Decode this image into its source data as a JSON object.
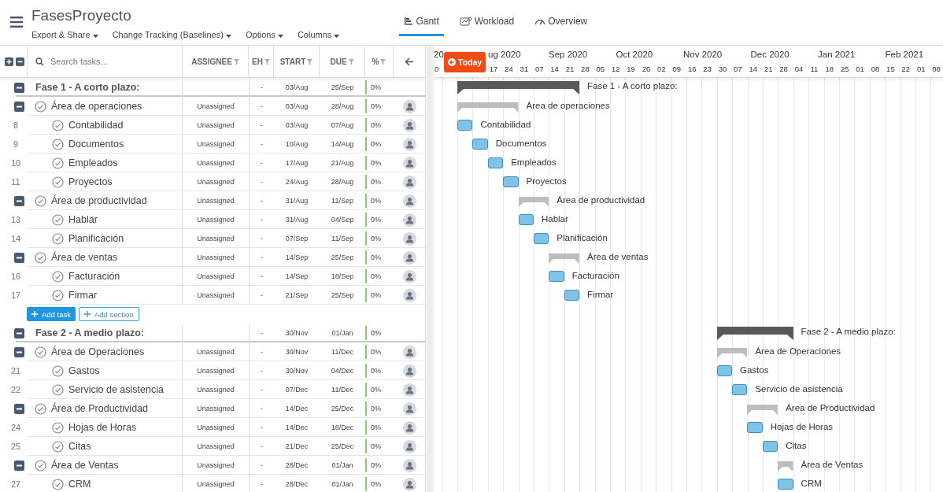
{
  "header": {
    "title": "FasesProyecto",
    "menus": [
      "Export & Share",
      "Change Tracking (Baselines)",
      "Options",
      "Columns"
    ]
  },
  "views": [
    {
      "label": "Gantt",
      "kind": "gantt",
      "selected": true
    },
    {
      "label": "Workload",
      "kind": "workload",
      "selected": false
    },
    {
      "label": "Overview",
      "kind": "overview",
      "selected": false
    }
  ],
  "table": {
    "search": {
      "placeholder": "Search tasks..."
    },
    "columns": [
      "ASSIGNEE",
      "EH",
      "START",
      "DUE",
      "%"
    ]
  },
  "sections": [
    {
      "rows": [
        {
          "kind": "phase",
          "name": "Fase 1 - A corto plazo:",
          "eh": "-",
          "start": "03/Aug",
          "due": "25/Sep",
          "pct": "0%",
          "bar_label": "Fase 1 - A corto plazo:"
        },
        {
          "kind": "group",
          "name": "Área de operaciones",
          "assignee": "Unassigned",
          "eh": "-",
          "start": "03/Aug",
          "due": "28/Aug",
          "pct": "0%",
          "bar_label": "Área de operaciones"
        },
        {
          "kind": "task",
          "number": "8",
          "name": "Contabilidad",
          "assignee": "Unassigned",
          "eh": "-",
          "start": "03/Aug",
          "due": "07/Aug",
          "pct": "0%",
          "bar_label": "Contabilidad"
        },
        {
          "kind": "task",
          "number": "9",
          "name": "Documentos",
          "assignee": "Unassigned",
          "eh": "-",
          "start": "10/Aug",
          "due": "14/Aug",
          "pct": "0%",
          "bar_label": "Documentos"
        },
        {
          "kind": "task",
          "number": "10",
          "name": "Empleados",
          "assignee": "Unassigned",
          "eh": "-",
          "start": "17/Aug",
          "due": "21/Aug",
          "pct": "0%",
          "bar_label": "Empleados"
        },
        {
          "kind": "task",
          "number": "11",
          "name": "Proyectos",
          "assignee": "Unassigned",
          "eh": "-",
          "start": "24/Aug",
          "due": "28/Aug",
          "pct": "0%",
          "bar_label": "Proyectos"
        },
        {
          "kind": "group",
          "name": "Área de productividad",
          "assignee": "Unassigned",
          "eh": "-",
          "start": "31/Aug",
          "due": "11/Sep",
          "pct": "0%",
          "bar_label": "Área de productividad"
        },
        {
          "kind": "task",
          "number": "13",
          "name": "Hablar",
          "assignee": "Unassigned",
          "eh": "-",
          "start": "31/Aug",
          "due": "04/Sep",
          "pct": "0%",
          "bar_label": "Hablar"
        },
        {
          "kind": "task",
          "number": "14",
          "name": "Planificación",
          "assignee": "Unassigned",
          "eh": "-",
          "start": "07/Sep",
          "due": "11/Sep",
          "pct": "0%",
          "bar_label": "Planificación"
        },
        {
          "kind": "group",
          "name": "Área de ventas",
          "assignee": "Unassigned",
          "eh": "-",
          "start": "14/Sep",
          "due": "25/Sep",
          "pct": "0%",
          "bar_label": "Área de ventas"
        },
        {
          "kind": "task",
          "number": "16",
          "name": "Facturación",
          "assignee": "Unassigned",
          "eh": "-",
          "start": "14/Sep",
          "due": "18/Sep",
          "pct": "0%",
          "bar_label": "Facturación"
        },
        {
          "kind": "task",
          "number": "17",
          "name": "Firmar",
          "assignee": "Unassigned",
          "eh": "-",
          "start": "21/Sep",
          "due": "25/Sep",
          "pct": "0%",
          "bar_label": "Firmar"
        }
      ],
      "actions": {
        "add_task": "Add task",
        "add_section": "Add section"
      }
    },
    {
      "rows": [
        {
          "kind": "phase",
          "name": "Fase 2 - A medio plazo:",
          "eh": "-",
          "start": "30/Nov",
          "due": "01/Jan",
          "pct": "0%",
          "bar_label": "Fase 2 - A medio plazo:"
        },
        {
          "kind": "group",
          "name": "Área de Operaciones",
          "assignee": "Unassigned",
          "eh": "-",
          "start": "30/Nov",
          "due": "11/Dec",
          "pct": "0%",
          "bar_label": "Área de Operaciones"
        },
        {
          "kind": "task",
          "number": "21",
          "name": "Gastos",
          "assignee": "Unassigned",
          "eh": "-",
          "start": "30/Nov",
          "due": "04/Dec",
          "pct": "0%",
          "bar_label": "Gastos"
        },
        {
          "kind": "task",
          "number": "22",
          "name": "Servicio de asistencia",
          "assignee": "Unassigned",
          "eh": "-",
          "start": "07/Dec",
          "due": "11/Dec",
          "pct": "0%",
          "bar_label": "Servicio de asistencia"
        },
        {
          "kind": "group",
          "name": "Área de Productividad",
          "assignee": "Unassigned",
          "eh": "-",
          "start": "14/Dec",
          "due": "25/Dec",
          "pct": "0%",
          "bar_label": "Área de Productividad"
        },
        {
          "kind": "task",
          "number": "24",
          "name": "Hojas de Horas",
          "assignee": "Unassigned",
          "eh": "-",
          "start": "14/Dec",
          "due": "18/Dec",
          "pct": "0%",
          "bar_label": "Hojas de Horas"
        },
        {
          "kind": "task",
          "number": "25",
          "name": "Citas",
          "assignee": "Unassigned",
          "eh": "-",
          "start": "21/Dec",
          "due": "25/Dec",
          "pct": "0%",
          "bar_label": "Citas"
        },
        {
          "kind": "group",
          "name": "Área de Ventas",
          "assignee": "Unassigned",
          "eh": "-",
          "start": "28/Dec",
          "due": "01/Jan",
          "pct": "0%",
          "bar_label": "Área de Ventas"
        },
        {
          "kind": "task",
          "number": "27",
          "name": "CRM",
          "assignee": "Unassigned",
          "eh": "-",
          "start": "28/Dec",
          "due": "01/Jan",
          "pct": "0%",
          "bar_label": "CRM"
        }
      ]
    }
  ],
  "timeline": {
    "today": "Today",
    "months": [
      "20",
      "ug 2020",
      "Sep 2020",
      "Oct 2020",
      "Nov 2020",
      "Dec 2020",
      "Jan 2021",
      "Feb 2021"
    ],
    "weeks": [
      "0",
      "17",
      "24",
      "31",
      "07",
      "14",
      "21",
      "28",
      "05",
      "12",
      "19",
      "26",
      "02",
      "09",
      "16",
      "23",
      "30",
      "07",
      "14",
      "21",
      "28",
      "04",
      "11",
      "18",
      "25",
      "01",
      "08",
      "15",
      "22",
      "01",
      "08"
    ]
  }
}
